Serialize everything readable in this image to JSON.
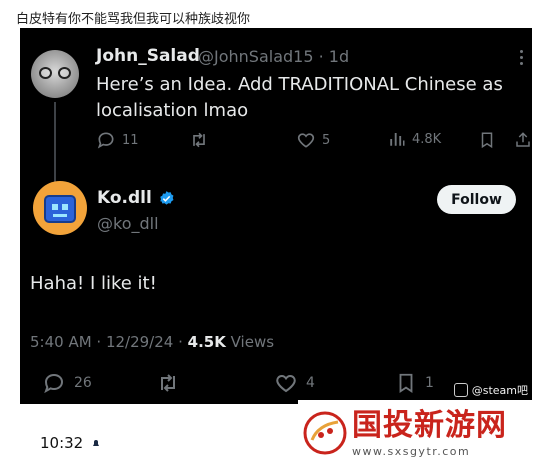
{
  "caption": "白皮特有你不能骂我但我可以种族歧视你",
  "reply_tweet": {
    "name": "John_Salad",
    "handle_time": "@JohnSalad15 · 1d",
    "text": "Here’s an Idea. Add TRADITIONAL Chinese as localisation lmao",
    "replies": "11",
    "likes": "5",
    "views": "4.8K"
  },
  "main_tweet": {
    "name": "Ko.dll",
    "handle": "@ko_dll",
    "follow_label": "Follow",
    "text": "Haha! I like it!",
    "timestamp": "5:40 AM · 12/29/24 · ",
    "views_count": "4.5K",
    "views_label": " Views",
    "replies": "26",
    "likes": "4",
    "bookmarks": "1"
  },
  "screenshot_watermark": "@steam吧",
  "status_time": "10:32",
  "site_logo": {
    "title": "国投新游网",
    "url": "www.sxsgytr.com"
  },
  "colors": {
    "background": "#000000",
    "text_primary": "#e7e9ea",
    "text_secondary": "#71767b",
    "verified": "#1d9bf0",
    "logo_red": "#c9241c"
  }
}
